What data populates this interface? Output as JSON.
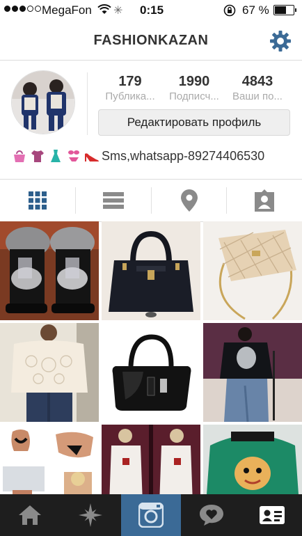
{
  "status_bar": {
    "carrier": "MegaFon",
    "time": "0:15",
    "battery_percent_label": "67 %",
    "battery_level": 0.67,
    "signal_bars_filled": 3,
    "signal_bars_total": 5
  },
  "nav": {
    "title": "FASHIONKAZAN",
    "settings_icon": "gear-icon"
  },
  "profile": {
    "stats": [
      {
        "value": "179",
        "label": "Публика..."
      },
      {
        "value": "1990",
        "label": "Подписч..."
      },
      {
        "value": "4843",
        "label": "Ваши по..."
      }
    ],
    "edit_button_label": "Редактировать профиль",
    "bio_emoji": [
      "handbag-emoji",
      "shirt-emoji",
      "dress-emoji",
      "bikini-emoji",
      "high-heel-emoji"
    ],
    "bio_text": "Sms,whatsapp-89274406530"
  },
  "view_tabs": [
    {
      "name": "grid-view-icon",
      "active": true
    },
    {
      "name": "list-view-icon",
      "active": false
    },
    {
      "name": "location-icon",
      "active": false
    },
    {
      "name": "tagged-photos-icon",
      "active": false
    }
  ],
  "photos": [
    "fur-boots-photo",
    "black-handbag-photo",
    "quilted-bag-photo",
    "lace-sweater-photo",
    "black-glossy-bag-photo",
    "graphic-sweatshirt-photo",
    "swimwear-photo",
    "white-tracksuit-photo",
    "green-sweatshirt-photo"
  ],
  "bottom_tabs": [
    {
      "name": "home-icon",
      "active": false
    },
    {
      "name": "explore-icon",
      "active": false
    },
    {
      "name": "camera-icon",
      "active": true
    },
    {
      "name": "activity-icon",
      "active": false
    },
    {
      "name": "profile-icon",
      "active": false
    }
  ],
  "colors": {
    "accent_blue": "#3b6a96",
    "grid_icon_blue": "#2d5f8c",
    "tab_gray": "#8a8a8a",
    "tabbar_bg": "#1e1e1e"
  }
}
